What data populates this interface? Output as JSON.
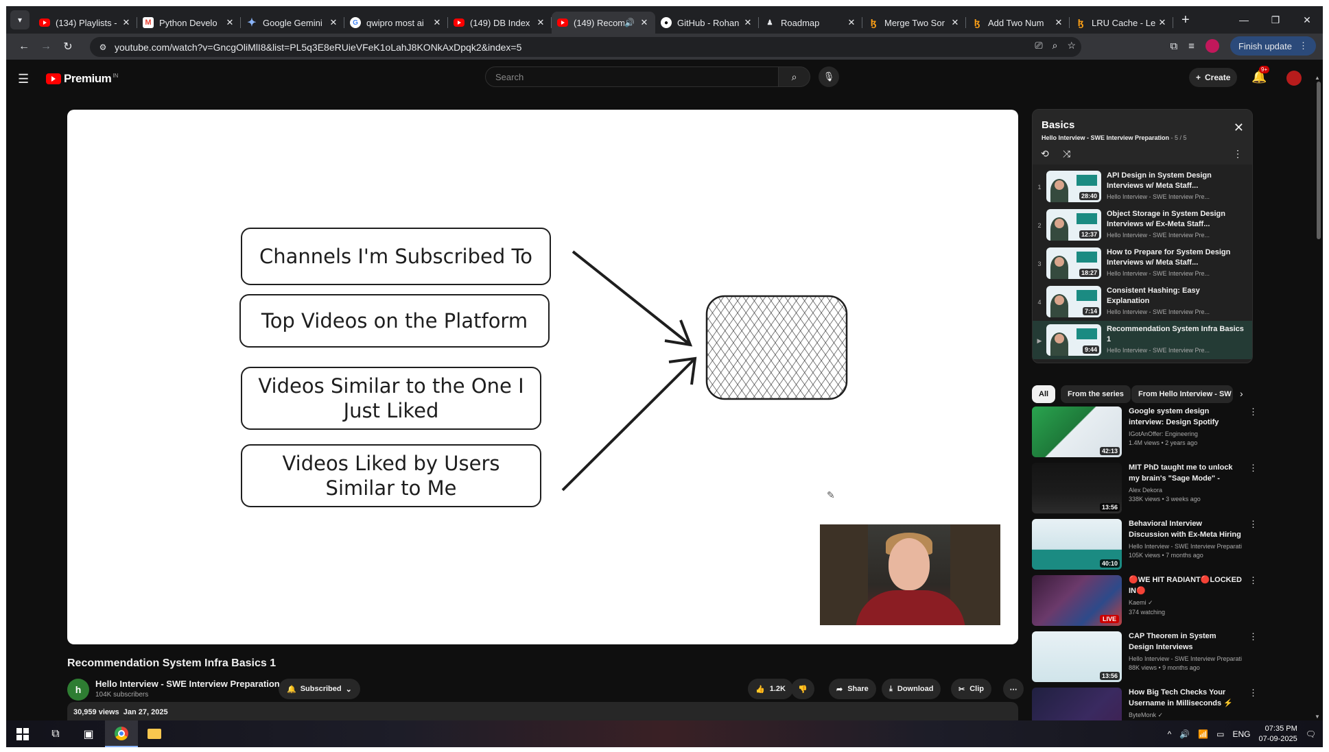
{
  "browser": {
    "tabs": [
      {
        "title": "(134) Playlists -",
        "icon": "youtube-icon",
        "active": false
      },
      {
        "title": "Python Develo",
        "icon": "gmail-icon",
        "active": false
      },
      {
        "title": "Google Gemini",
        "icon": "gemini-icon",
        "active": false
      },
      {
        "title": "qwipro most ai",
        "icon": "google-icon",
        "active": false
      },
      {
        "title": "(149) DB Index",
        "icon": "youtube-icon",
        "active": false
      },
      {
        "title": "(149) Recom",
        "icon": "youtube-icon",
        "active": true
      },
      {
        "title": "GitHub - Rohan",
        "icon": "github-icon",
        "active": false
      },
      {
        "title": "Roadmap",
        "icon": "roadmap-icon",
        "active": false
      },
      {
        "title": "Merge Two Sor",
        "icon": "leetcode-icon",
        "active": false
      },
      {
        "title": "Add Two Num",
        "icon": "leetcode-icon",
        "active": false
      },
      {
        "title": "LRU Cache - Le",
        "icon": "leetcode-icon",
        "active": false
      }
    ],
    "url": "youtube.com/watch?v=GncgOliMlI8&list=PL5q3E8eRUieVFeK1oLahJ8KONkAxDpqk2&index=5",
    "finish_update_label": "Finish update"
  },
  "youtube": {
    "logo_text": "Premium",
    "logo_region": "IN",
    "search_placeholder": "Search",
    "create_label": "Create",
    "notifications_badge": "9+"
  },
  "whiteboard": {
    "boxes": [
      "Channels I'm Subscribed To",
      "Top Videos on the Platform",
      "Videos Similar to the One I Just Liked",
      "Videos Liked by Users Similar to Me"
    ]
  },
  "video": {
    "title": "Recommendation System Infra Basics 1",
    "channel": "Hello Interview - SWE Interview Preparation",
    "subscribers": "104K subscribers",
    "subscribe_label": "Subscribed",
    "likes": "1.2K",
    "share_label": "Share",
    "download_label": "Download",
    "clip_label": "Clip",
    "views": "30,959 views",
    "date": "Jan 27, 2025"
  },
  "playlist": {
    "title": "Basics",
    "owner": "Hello Interview - SWE Interview Preparation",
    "position": "5 / 5",
    "items": [
      {
        "index": "1",
        "title": "API Design in System Design Interviews w/ Meta Staff...",
        "channel": "Hello Interview - SWE Interview Pre...",
        "duration": "28:40",
        "current": false
      },
      {
        "index": "2",
        "title": "Object Storage in System Design Interviews w/ Ex-Meta Staff...",
        "channel": "Hello Interview - SWE Interview Pre...",
        "duration": "12:37",
        "current": false
      },
      {
        "index": "3",
        "title": "How to Prepare for System Design Interviews w/ Meta Staff...",
        "channel": "Hello Interview - SWE Interview Pre...",
        "duration": "18:27",
        "current": false
      },
      {
        "index": "4",
        "title": "Consistent Hashing: Easy Explanation",
        "channel": "Hello Interview - SWE Interview Pre...",
        "duration": "7:14",
        "current": false
      },
      {
        "index": "▶",
        "title": "Recommendation System Infra Basics 1",
        "channel": "Hello Interview - SWE Interview Pre...",
        "duration": "9:44",
        "current": true
      }
    ]
  },
  "chips": [
    "All",
    "From the series",
    "From Hello Interview - SW"
  ],
  "recommendations": [
    {
      "title": "Google system design interview: Design Spotify (with...",
      "channel": "IGotAnOffer: Engineering",
      "meta": "1.4M views • 2 years ago",
      "duration": "42:13",
      "thumb_color": "#2aa44f"
    },
    {
      "title": "MIT PhD taught me to unlock my brain's \"Sage Mode\" - Deep...",
      "channel": "Alex Dekora",
      "meta": "338K views • 3 weeks ago",
      "duration": "13:56",
      "thumb_color": "#111111"
    },
    {
      "title": "Behavioral Interview Discussion with Ex-Meta Hiring Committe...",
      "channel": "Hello Interview - SWE Interview Preparati...",
      "meta": "105K views • 7 months ago",
      "duration": "40:10",
      "thumb_color": "#1b8b82"
    },
    {
      "title": "🔴WE HIT RADIANT🔴LOCKED IN🔴",
      "channel": "Kaemi ✓",
      "meta": "374 watching",
      "duration": "LIVE",
      "thumb_color": "#5a2a50"
    },
    {
      "title": "CAP Theorem in System Design Interviews",
      "channel": "Hello Interview - SWE Interview Preparati...",
      "meta": "88K views • 9 months ago",
      "duration": "13:56",
      "thumb_color": "#1b8b82"
    },
    {
      "title": "How Big Tech Checks Your Username in Milliseconds ⚡",
      "channel": "ByteMonk ✓",
      "meta": "",
      "duration": "",
      "thumb_color": "#202040"
    }
  ],
  "taskbar": {
    "time": "07:35 PM",
    "date": "07-09-2025",
    "language": "ENG"
  }
}
